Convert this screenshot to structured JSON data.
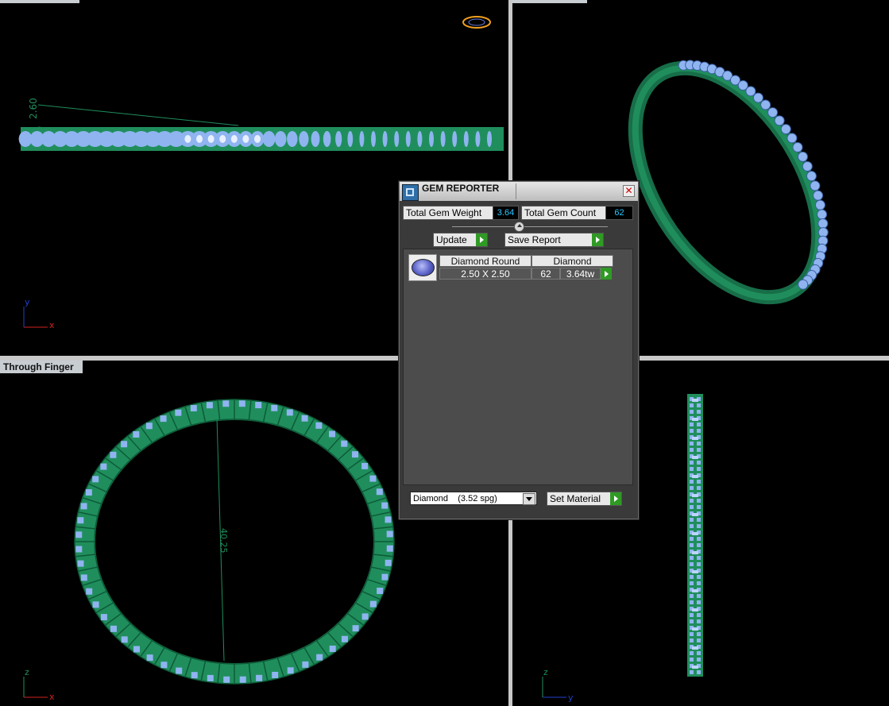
{
  "viewports": {
    "top_left": {
      "label": "",
      "dimension": "2.60",
      "axis_x": "x",
      "axis_y": "y"
    },
    "top_right": {
      "label": ""
    },
    "bottom_left": {
      "label": "Through Finger",
      "dimension": "40.25",
      "axis_x": "x",
      "axis_y": "z"
    },
    "bottom_right": {
      "label": "",
      "axis_x": "y",
      "axis_y": "z"
    }
  },
  "dialog": {
    "title": "GEM REPORTER",
    "close_glyph": "✕",
    "total_weight_label": "Total Gem Weight",
    "total_weight_value": "3.64",
    "total_count_label": "Total Gem Count",
    "total_count_value": "62",
    "update_label": "Update",
    "save_report_label": "Save Report",
    "report": {
      "header": [
        "Diamond Round",
        "Diamond"
      ],
      "row": {
        "size": "2.50 X 2.50",
        "count": "62",
        "weight": "3.64tw"
      }
    },
    "material_select": "Diamond    (3.52 spg)",
    "set_material_label": "Set Material"
  },
  "colors": {
    "metal": "#1f8e5c",
    "gem": "#8fb4f0",
    "accent_value": "#27c6ff",
    "go_button": "#2f9a24"
  }
}
